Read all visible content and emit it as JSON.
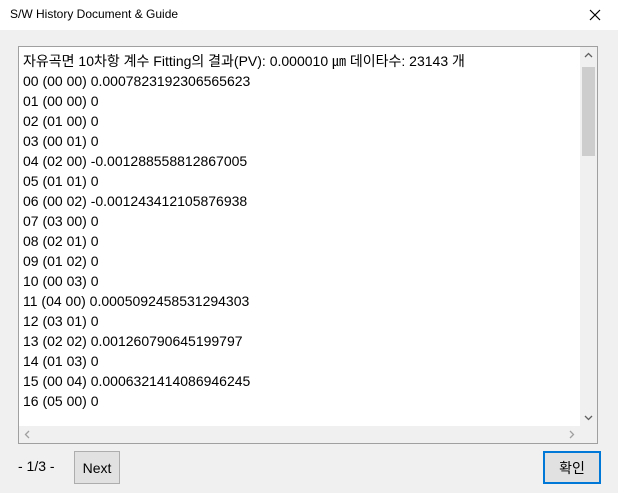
{
  "window": {
    "title": "S/W History Document & Guide",
    "close_icon": "close-icon"
  },
  "content": {
    "lines": [
      "자유곡면 10차항 계수 Fitting의 결과(PV): 0.000010 ㎛ 데이타수: 23143 개",
      "00 (00 00) 0.0007823192306565623",
      "01 (00 00) 0",
      "02 (01 00) 0",
      "03 (00 01) 0",
      "04 (02 00) -0.001288558812867005",
      "05 (01 01) 0",
      "06 (00 02) -0.001243412105876938",
      "07 (03 00) 0",
      "08 (02 01) 0",
      "09 (01 02) 0",
      "10 (00 03) 0",
      "11 (04 00) 0.0005092458531294303",
      "12 (03 01) 0",
      "13 (02 02) 0.001260790645199797",
      "14 (01 03) 0",
      "15 (00 04) 0.0006321414086946245",
      "16 (05 00) 0"
    ]
  },
  "footer": {
    "page_indicator": "- 1/3 -",
    "next_label": "Next",
    "ok_label": "확인"
  }
}
